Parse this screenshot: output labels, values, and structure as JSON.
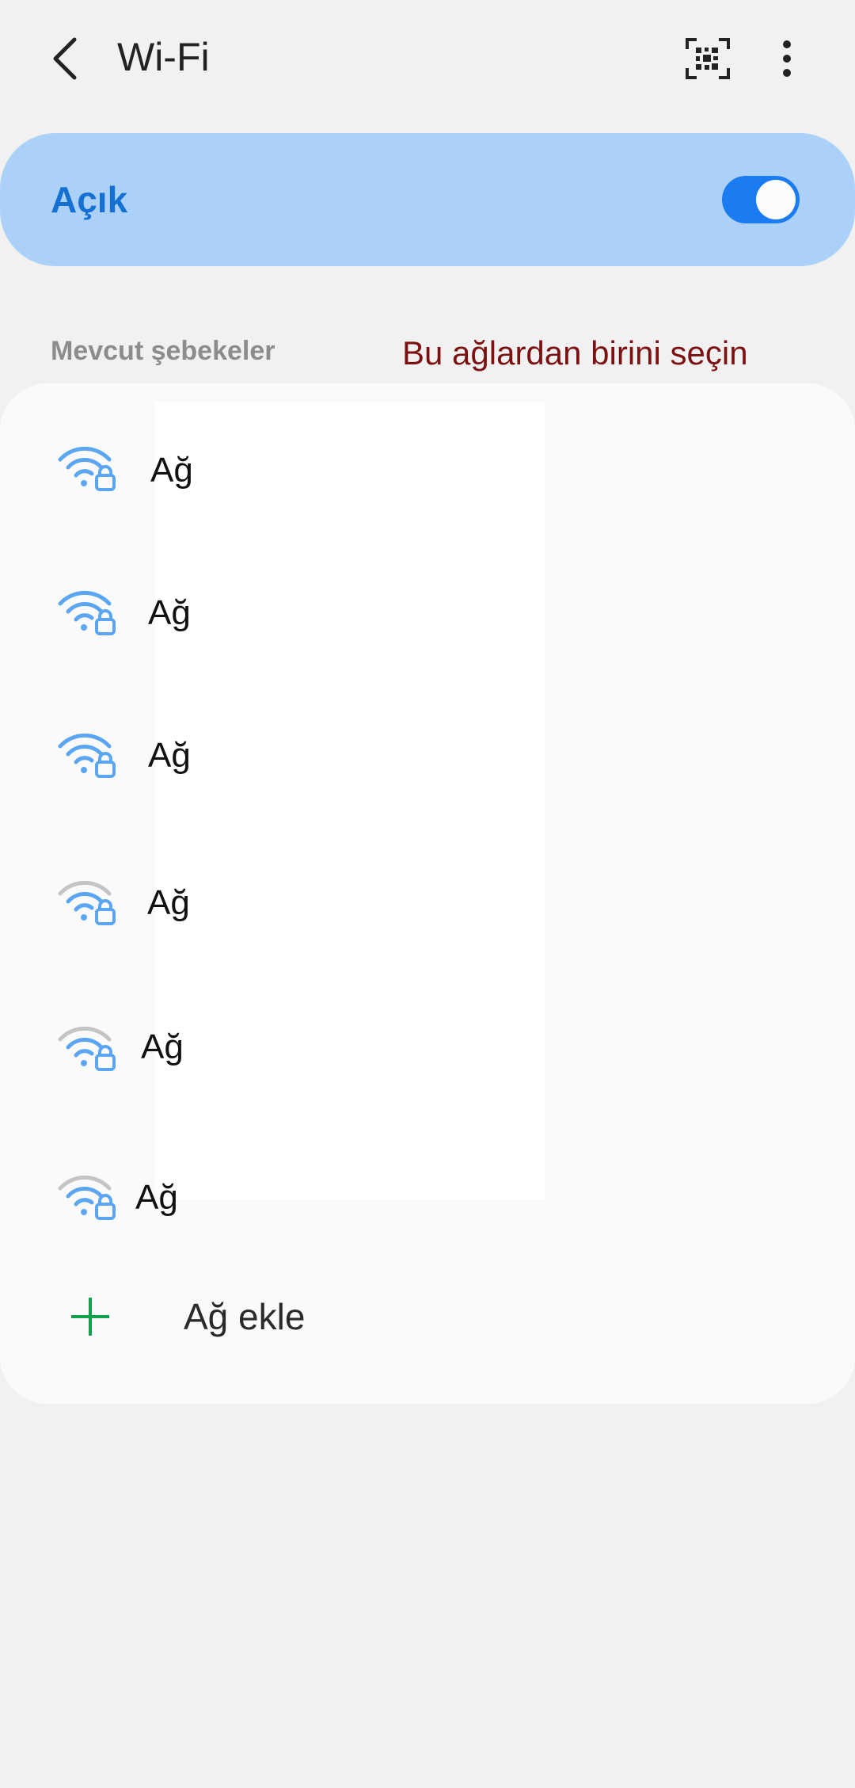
{
  "header": {
    "title": "Wi-Fi",
    "back_icon": "chevron-left-icon",
    "qr_icon": "qr-code-icon",
    "more_icon": "more-vertical-icon"
  },
  "wifi_toggle": {
    "label": "Açık",
    "enabled": true,
    "accent_color": "#1a7cf0"
  },
  "networks_section": {
    "header": "Mevcut şebekeler",
    "annotation": "Bu ağlardan birini seçin"
  },
  "networks": [
    {
      "name": "Ağ",
      "signal": "strong",
      "secured": true
    },
    {
      "name": "Ağ",
      "signal": "strong",
      "secured": true
    },
    {
      "name": "Ağ",
      "signal": "strong",
      "secured": true
    },
    {
      "name": "Ağ",
      "signal": "weak",
      "secured": true
    },
    {
      "name": "Ağ",
      "signal": "weak",
      "secured": true
    },
    {
      "name": "Ağ",
      "signal": "weak",
      "secured": true
    }
  ],
  "add_network": {
    "label": "Ağ ekle",
    "icon": "plus-icon"
  }
}
